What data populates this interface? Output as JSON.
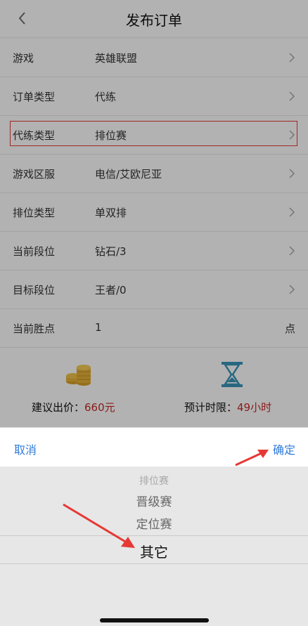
{
  "header": {
    "title": "发布订单"
  },
  "rows": [
    {
      "label": "游戏",
      "value": "英雄联盟",
      "chevron": true,
      "unit": ""
    },
    {
      "label": "订单类型",
      "value": "代练",
      "chevron": true,
      "unit": ""
    },
    {
      "label": "代练类型",
      "value": "排位赛",
      "chevron": true,
      "unit": ""
    },
    {
      "label": "游戏区服",
      "value": "电信/艾欧尼亚",
      "chevron": true,
      "unit": ""
    },
    {
      "label": "排位类型",
      "value": "单双排",
      "chevron": true,
      "unit": ""
    },
    {
      "label": "当前段位",
      "value": "钻石/3",
      "chevron": true,
      "unit": ""
    },
    {
      "label": "目标段位",
      "value": "王者/0",
      "chevron": true,
      "unit": ""
    },
    {
      "label": "当前胜点",
      "value": "1",
      "chevron": false,
      "unit": "点"
    }
  ],
  "summary": {
    "price_label": "建议出价：",
    "price_value": "660元",
    "time_label": "预计时限：",
    "time_value": "49小时"
  },
  "sheet": {
    "cancel": "取消",
    "confirm": "确定",
    "options": [
      "排位赛",
      "晋级赛",
      "定位赛",
      "其它"
    ],
    "selected": "其它"
  },
  "colors": {
    "accent": "#2f7bd8",
    "price": "#c62828",
    "highlight": "#e53935",
    "annotation_arrow": "#e53935"
  },
  "icons": {
    "back": "chevron-left-icon",
    "coins": "coin-stack-icon",
    "time": "hourglass-icon"
  }
}
